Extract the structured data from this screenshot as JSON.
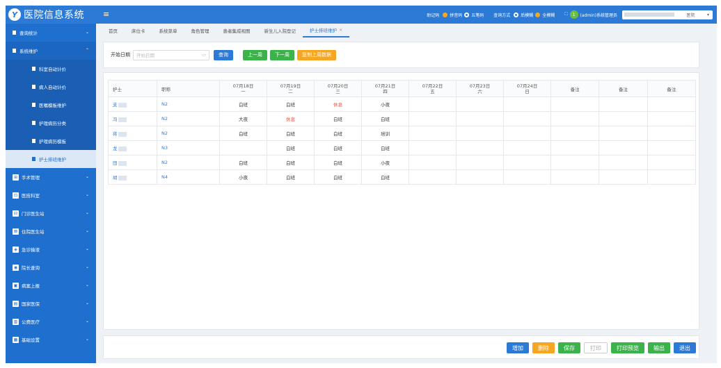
{
  "app": {
    "logo_char": "Y",
    "title": "医院信息系统",
    "menu_icon": "menu-icon"
  },
  "topbar": {
    "help_code_label": "助记码",
    "pinyin_label": "拼音码",
    "wubi_label": "五笔码",
    "query_mode_label": "查询方式",
    "suffix_label": "后模糊",
    "full_label": "全模糊",
    "fullscreen_icon": "fullscreen-icon",
    "user_label": "(admin)系统管理员",
    "hospital_suffix": "医院",
    "avatar_char": "1"
  },
  "sidebar": {
    "items": [
      {
        "label": "查询统计",
        "type": "parent-collapsed"
      },
      {
        "label": "系统维护",
        "type": "parent-expanded"
      },
      {
        "label": "科室自动计价",
        "type": "sub"
      },
      {
        "label": "病人自动计价",
        "type": "sub"
      },
      {
        "label": "医嘱模板维护",
        "type": "sub"
      },
      {
        "label": "护理病历分类",
        "type": "sub"
      },
      {
        "label": "护理病历模板",
        "type": "sub"
      },
      {
        "label": "护士排班维护",
        "type": "sub-active"
      },
      {
        "label": "手术管理",
        "icon": "surgery-icon"
      },
      {
        "label": "医技科室",
        "icon": "medtech-icon"
      },
      {
        "label": "门诊医生站",
        "icon": "clinic-icon"
      },
      {
        "label": "住院医生站",
        "icon": "inpatient-icon"
      },
      {
        "label": "急诊输液",
        "icon": "infusion-icon"
      },
      {
        "label": "院长查询",
        "icon": "director-icon"
      },
      {
        "label": "病案上报",
        "icon": "report-icon"
      },
      {
        "label": "国家医保",
        "icon": "insurance-icon"
      },
      {
        "label": "公费医疗",
        "icon": "public-medical-icon"
      },
      {
        "label": "基础设置",
        "icon": "settings-icon"
      }
    ]
  },
  "tabs": [
    {
      "label": "首页"
    },
    {
      "label": "床位卡"
    },
    {
      "label": "系统菜单"
    },
    {
      "label": "角色管理"
    },
    {
      "label": "患者集成视图"
    },
    {
      "label": "新生儿入院登记"
    },
    {
      "label": "护士排班维护",
      "active": true
    }
  ],
  "filter": {
    "start_label": "开始日期",
    "start_placeholder": "开始日期",
    "query_btn": "查询",
    "prev_week_btn": "上一周",
    "next_week_btn": "下一周",
    "copy_btn": "复制上周数据"
  },
  "table": {
    "col_nurse": "护士",
    "col_title": "职称",
    "days": [
      {
        "date": "07月18日",
        "weekday": "一"
      },
      {
        "date": "07月19日",
        "weekday": "二"
      },
      {
        "date": "07月20日",
        "weekday": "三"
      },
      {
        "date": "07月21日",
        "weekday": "四"
      },
      {
        "date": "07月22日",
        "weekday": "五"
      },
      {
        "date": "07月23日",
        "weekday": "六"
      },
      {
        "date": "07月24日",
        "weekday": "日"
      }
    ],
    "notes": [
      "备注",
      "备注",
      "备注"
    ],
    "rows": [
      {
        "name": "支",
        "title": "N2",
        "shifts": [
          "白班",
          "白班",
          "休息",
          "小夜",
          "",
          "",
          ""
        ]
      },
      {
        "name": "冯",
        "title": "N2",
        "shifts": [
          "大夜",
          "休息",
          "白班",
          "白班",
          "",
          "",
          ""
        ]
      },
      {
        "name": "蒋",
        "title": "N2",
        "shifts": [
          "白班",
          "白班",
          "白班",
          "培训",
          "",
          "",
          ""
        ]
      },
      {
        "name": "龙",
        "title": "N3",
        "shifts": [
          "",
          "白班",
          "白班",
          "白班",
          "",
          "",
          ""
        ]
      },
      {
        "name": "田",
        "title": "N2",
        "shifts": [
          "白班",
          "白班",
          "白班",
          "小夜",
          "",
          "",
          ""
        ]
      },
      {
        "name": "胡",
        "title": "N4",
        "shifts": [
          "小夜",
          "白班",
          "白班",
          "白班",
          "",
          "",
          ""
        ]
      }
    ],
    "rest_label": "休息"
  },
  "footer": {
    "add": "增加",
    "delete": "删除",
    "save": "保存",
    "print": "打印",
    "preview": "打印预览",
    "export": "输出",
    "exit": "退出"
  },
  "colors": {
    "primary": "#2d7ad6",
    "green": "#3cb34a",
    "orange": "#f5a623",
    "rest_red": "#e74c3c"
  }
}
